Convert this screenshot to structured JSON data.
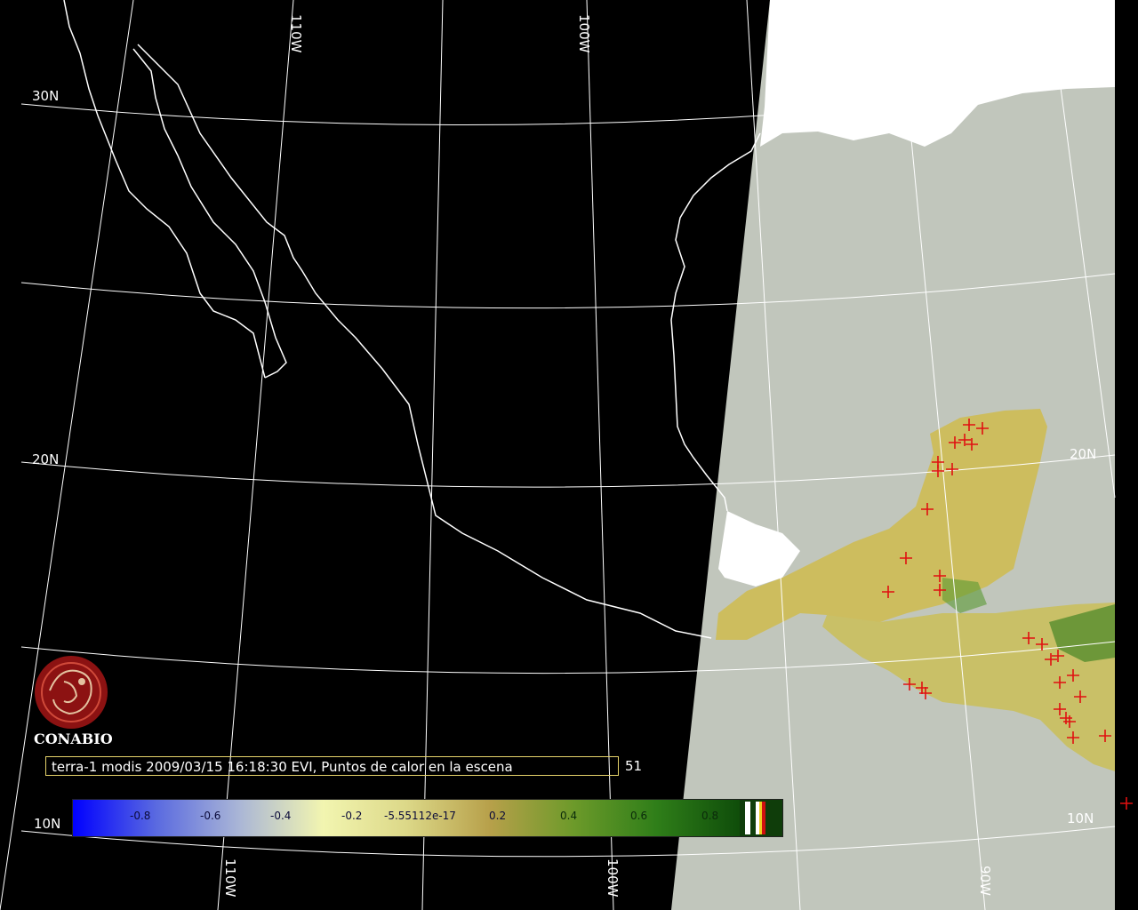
{
  "map": {
    "logo_text": "CONABIO",
    "caption": "terra-1 modis 2009/03/15 16:18:30 EVI, Puntos de calor en la escena",
    "hotspot_count": "51",
    "lat_labels": [
      "30N",
      "20N",
      "20N",
      "10N",
      "10N"
    ],
    "lon_labels": [
      "110W",
      "100W",
      "110W",
      "100W",
      "90W"
    ],
    "colors": {
      "background": "#000000",
      "cloud": "#ffffff",
      "ocean_scene": "#c1c6bc",
      "graticule": "#ffffff",
      "hotspot": "#e01010",
      "caption_border": "#e6d36a"
    }
  },
  "colorbar": {
    "ticks": [
      "-0.8",
      "-0.6",
      "-0.4",
      "-0.2",
      "-5.55112e-17",
      "0.2",
      "0.4",
      "0.6",
      "0.8"
    ],
    "stops": [
      "#0000ff",
      "#5a6ae0",
      "#aab6d6",
      "#f2f5b0",
      "#dcd888",
      "#b7a04a",
      "#6d9a2a",
      "#2f7e19",
      "#0f4d0a"
    ]
  }
}
